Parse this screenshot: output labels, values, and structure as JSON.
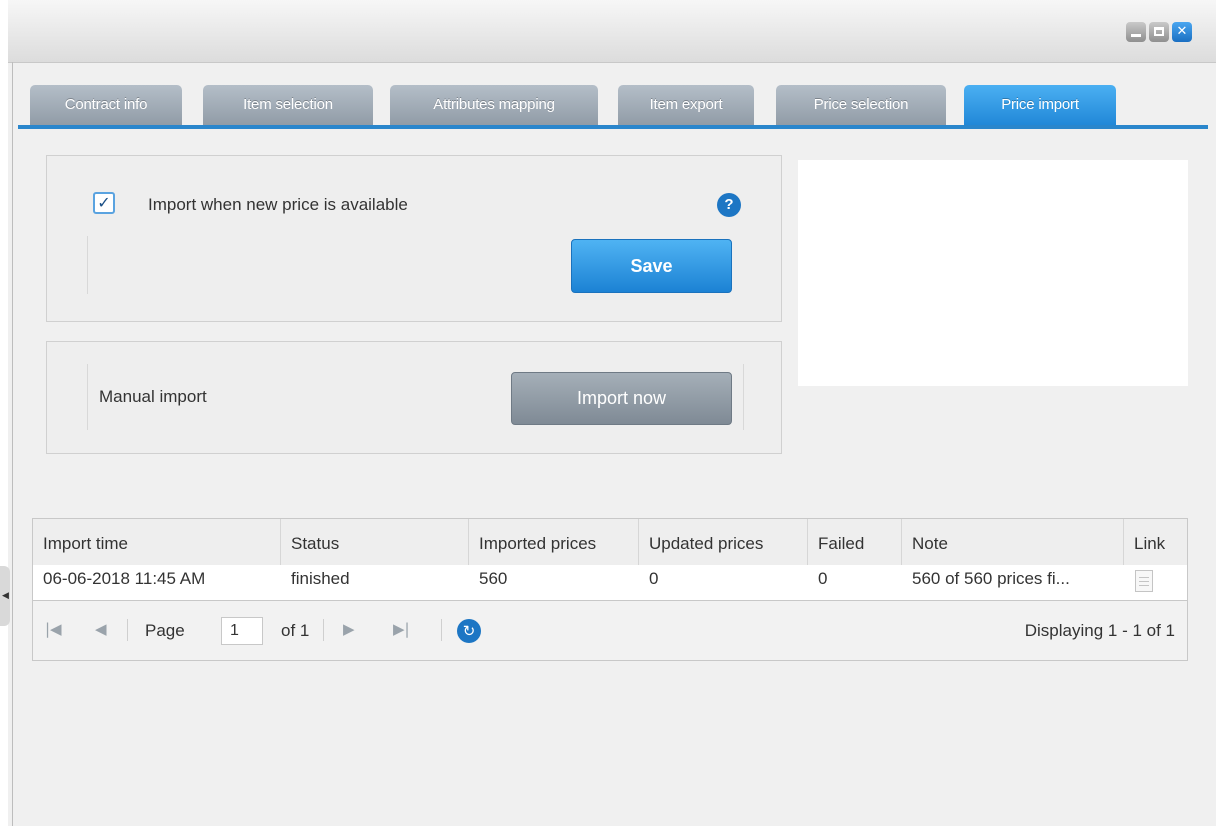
{
  "window": {
    "controls": {
      "minimize": "minimize",
      "maximize": "maximize",
      "close": "close"
    },
    "close_glyph": "✕"
  },
  "tabs": [
    {
      "label": "Contract info",
      "active": false
    },
    {
      "label": "Item selection",
      "active": false
    },
    {
      "label": "Attributes mapping",
      "active": false
    },
    {
      "label": "Item export",
      "active": false
    },
    {
      "label": "Price selection",
      "active": false
    },
    {
      "label": "Price import",
      "active": true
    }
  ],
  "auto_import": {
    "checked": true,
    "check_glyph": "✓",
    "label": "Import when new price is available",
    "help_glyph": "?",
    "save_label": "Save"
  },
  "manual_import": {
    "label": "Manual import",
    "button_label": "Import now"
  },
  "grid": {
    "columns": [
      "Import time",
      "Status",
      "Imported prices",
      "Updated prices",
      "Failed",
      "Note",
      "Link"
    ],
    "rows": [
      [
        "06-06-2018 11:45 AM",
        "finished",
        "560",
        "0",
        "0",
        "560 of 560 prices fi..."
      ]
    ]
  },
  "pager": {
    "first_glyph": "|◀",
    "prev_glyph": "◀",
    "page_label": "Page",
    "page_value": "1",
    "of_label": "of 1",
    "next_glyph": "▶",
    "last_glyph": "▶|",
    "refresh_glyph": "↻",
    "display_text": "Displaying 1 - 1 of 1"
  },
  "colors": {
    "accent": "#2a86cc",
    "tab_inactive": "#9aa5b0",
    "button_primary": "#1c82d4",
    "button_secondary": "#8a949e"
  }
}
